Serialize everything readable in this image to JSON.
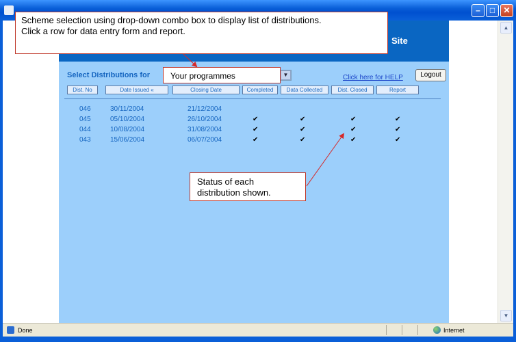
{
  "window": {
    "statusbar": {
      "left": "Done",
      "zone": "Internet"
    }
  },
  "site": {
    "title": "Site",
    "select_label": "Select Distributions for",
    "select_value": "Your programmes",
    "help_link": "Click here for HELP",
    "logout_label": "Logout",
    "columns": [
      "Dist. No",
      "Date Issued «",
      "Closing Date",
      "Completed",
      "Data Collected",
      "Dist. Closed",
      "Report"
    ],
    "rows": [
      {
        "no": "046",
        "issued": "30/11/2004",
        "closing": "21/12/2004",
        "completed": false,
        "collected": false,
        "closed": false,
        "report": false
      },
      {
        "no": "045",
        "issued": "05/10/2004",
        "closing": "26/10/2004",
        "completed": true,
        "collected": true,
        "closed": true,
        "report": true
      },
      {
        "no": "044",
        "issued": "10/08/2004",
        "closing": "31/08/2004",
        "completed": true,
        "collected": true,
        "closed": true,
        "report": true
      },
      {
        "no": "043",
        "issued": "15/06/2004",
        "closing": "06/07/2004",
        "completed": true,
        "collected": true,
        "closed": true,
        "report": true
      }
    ],
    "check_glyph": "✔"
  },
  "callouts": {
    "top_line1": "Scheme selection using drop-down combo box to display list of distributions.",
    "top_line2": "Click a row for data entry form and report.",
    "status_line1": "Status of each",
    "status_line2": "distribution shown."
  },
  "colors": {
    "header_blue": "#0a66c2",
    "panel_blue": "#9ccffb",
    "text_blue": "#1565c0",
    "callout_border": "#c0392b"
  }
}
